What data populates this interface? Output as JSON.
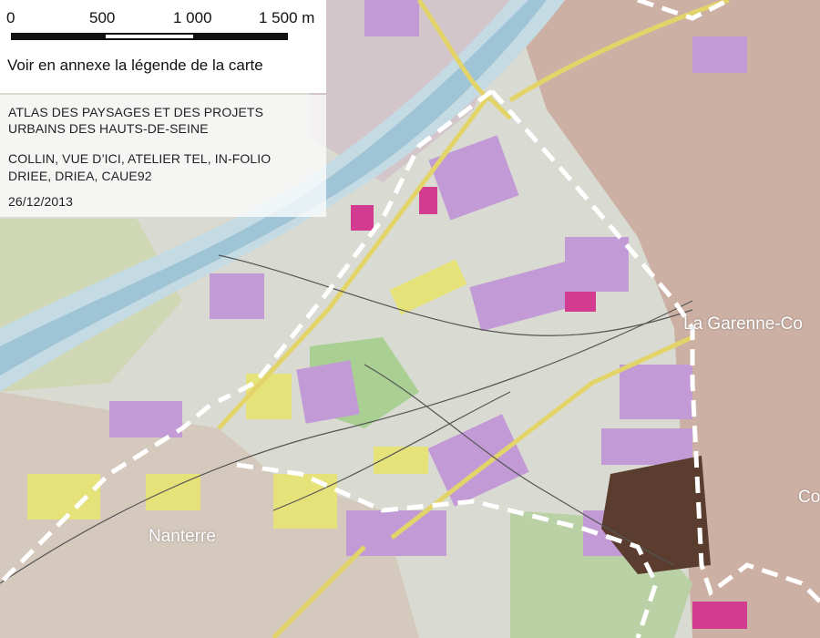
{
  "scale": {
    "labels": [
      "0",
      "500",
      "1 000",
      "1 500 m"
    ],
    "note": "Voir en annexe la légende de la carte"
  },
  "info": {
    "title_line1": "ATLAS DES PAYSAGES ET DES PROJETS",
    "title_line2": "URBAINS DES HAUTS-DE-SEINE",
    "authors_line1": "COLLIN, VUE D’ICI, ATELIER TEL, IN-FOLIO",
    "authors_line2": "DRIEE, DRIEA, CAUE92",
    "date": "26/12/2013"
  },
  "places": {
    "garenne": "La Garenne-Co",
    "nanterre": "Nanterre",
    "edge": "Co"
  },
  "colors": {
    "river": "#9fc6d8",
    "river_bank": "#c8dde6",
    "urban_fabric": "#c9a99e",
    "activity_zone": "#c59ad6",
    "housing_blocks": "#e5e27a",
    "green": "#9cc98a",
    "roads": "#e8d86a",
    "boundary": "#ffffff"
  }
}
